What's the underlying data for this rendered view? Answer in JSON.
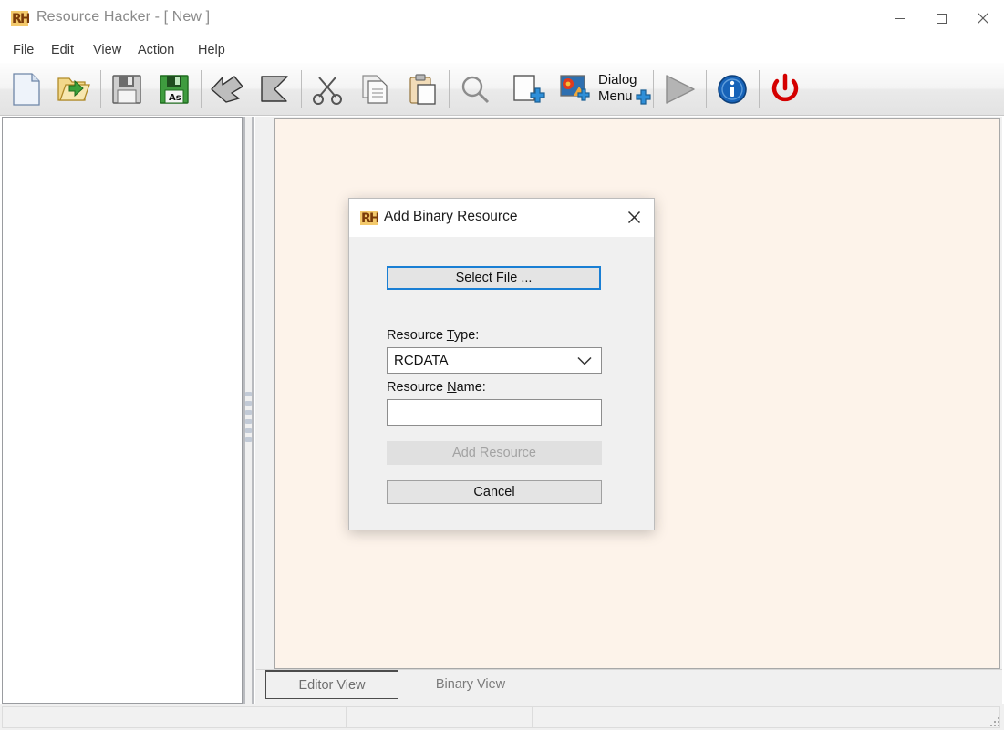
{
  "window": {
    "title": "Resource Hacker - [ New ]",
    "app_icon": "rh-logo-icon",
    "controls": {
      "minimize": "minimize-icon",
      "maximize": "maximize-icon",
      "close": "close-icon"
    }
  },
  "menu": {
    "items": [
      {
        "label": "File"
      },
      {
        "label": "Edit"
      },
      {
        "label": "View"
      },
      {
        "label": "Action"
      },
      {
        "label": "Help"
      }
    ]
  },
  "toolbar": {
    "buttons": [
      {
        "name": "new-file-icon",
        "tip": "New"
      },
      {
        "name": "open-file-icon",
        "tip": "Open"
      },
      {
        "name": "save-icon",
        "tip": "Save"
      },
      {
        "name": "save-as-icon",
        "tip": "Save As"
      },
      {
        "name": "undo-arrow-icon",
        "tip": "Undo"
      },
      {
        "name": "redo-arrow-icon",
        "tip": "Redo"
      },
      {
        "name": "cut-scissors-icon",
        "tip": "Cut"
      },
      {
        "name": "copy-icon",
        "tip": "Copy"
      },
      {
        "name": "paste-clipboard-icon",
        "tip": "Paste"
      },
      {
        "name": "search-magnifier-icon",
        "tip": "Find"
      },
      {
        "name": "add-binary-resource-icon",
        "tip": "Add Binary Resource"
      },
      {
        "name": "add-image-resource-icon",
        "tip": "Add Image Resource"
      },
      {
        "name": "add-dialog-menu-icon",
        "tip": "Add Dialog or Menu"
      },
      {
        "name": "compile-play-icon",
        "tip": "Compile"
      },
      {
        "name": "info-icon",
        "tip": "About"
      },
      {
        "name": "exit-power-icon",
        "tip": "Exit"
      }
    ],
    "dialog_menu_label_line1": "Dialog",
    "dialog_menu_label_line2": "Menu"
  },
  "tabs": {
    "items": [
      {
        "label": "Editor View",
        "accel": "d",
        "active": true
      },
      {
        "label": "Binary View",
        "accel": "n",
        "active": false
      }
    ]
  },
  "statusbar": {
    "panel1": "",
    "panel2": "",
    "panel3": "",
    "grip": "resize-grip-icon"
  },
  "dialog": {
    "title": "Add Binary Resource",
    "icon": "rh-logo-icon",
    "close_icon": "close-icon",
    "select_file_button": "Select File ...",
    "resource_type_label_pre": "Resource ",
    "resource_type_label_accel": "T",
    "resource_type_label_post": "ype:",
    "resource_type_value": "RCDATA",
    "resource_type_chevron": "chevron-down-icon",
    "resource_name_label_pre": "Resource ",
    "resource_name_label_accel": "N",
    "resource_name_label_post": "ame:",
    "resource_name_value": "",
    "resource_name_placeholder": "",
    "add_resource_button": "Add Resource",
    "cancel_button": "Cancel"
  },
  "colors": {
    "focus_blue": "#1a7fd4",
    "editor_background": "#fdf3ea",
    "window_background": "#f0f0f0",
    "accent_red": "#d40000"
  }
}
